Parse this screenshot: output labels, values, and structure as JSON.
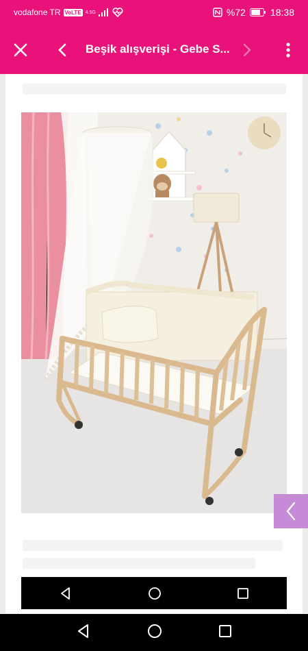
{
  "status_bar": {
    "carrier": "vodafone TR",
    "volte": "VoLTE",
    "network": "4.5G",
    "battery": "%72",
    "time": "18:38"
  },
  "toolbar": {
    "title": "Beşik alışverişi - Gebe S...",
    "icons": [
      "close-icon",
      "back-arrow-icon",
      "forward-arrow-icon",
      "more-vert-icon"
    ]
  },
  "colors": {
    "accent": "#e8127a",
    "side_tab": "#c58bd6"
  }
}
